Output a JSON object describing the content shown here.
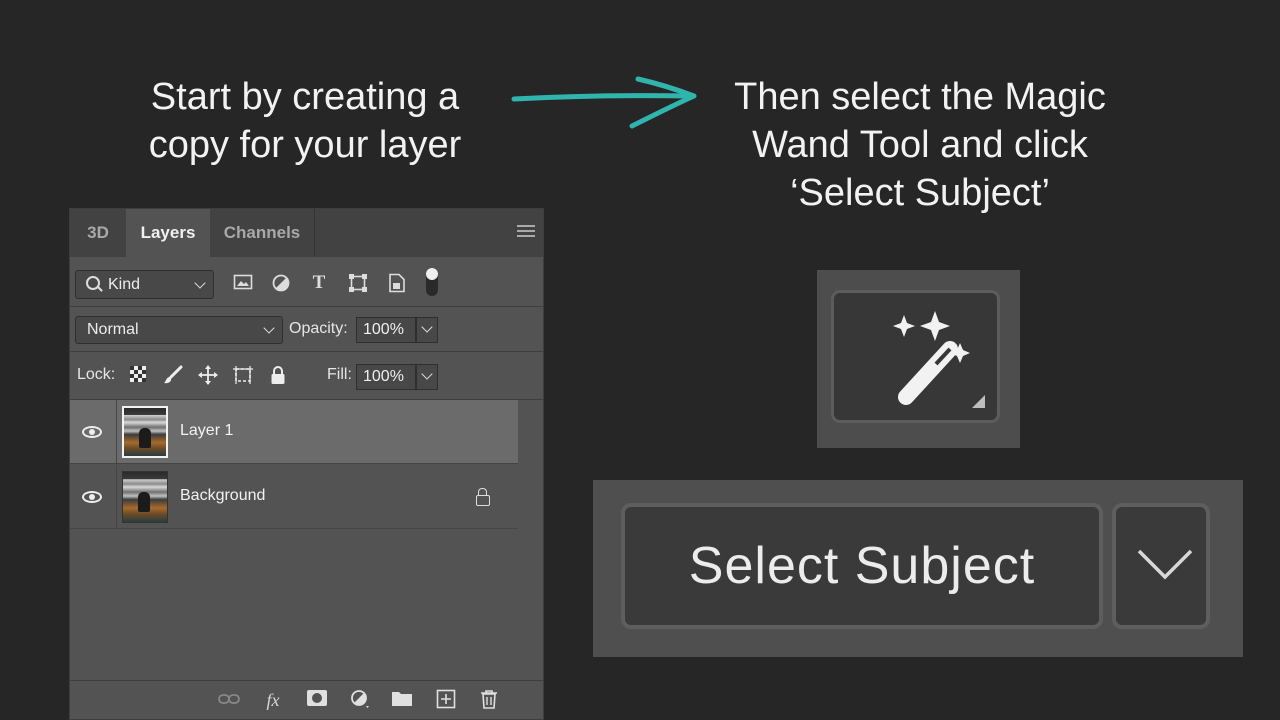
{
  "captions": {
    "left_line1": "Start by creating a",
    "left_line2": "copy for your layer",
    "right_line1": "Then select the Magic",
    "right_line2": "Wand Tool and click",
    "right_line3": "‘Select Subject’",
    "arrow_color": "#2fb5ad"
  },
  "panel": {
    "tabs": [
      "3D",
      "Layers",
      "Channels"
    ],
    "active_tab": "Layers",
    "filter": {
      "kind_label": "Kind",
      "icons": [
        "image-filter-icon",
        "adjustment-filter-icon",
        "type-filter-icon",
        "shape-filter-icon",
        "smart-object-filter-icon"
      ]
    },
    "blend_mode": "Normal",
    "opacity_label": "Opacity:",
    "opacity_value": "100%",
    "lock_label": "Lock:",
    "fill_label": "Fill:",
    "fill_value": "100%",
    "layers": [
      {
        "name": "Layer 1",
        "selected": true,
        "visible": true,
        "locked": false
      },
      {
        "name": "Background",
        "selected": false,
        "visible": true,
        "locked": true
      }
    ],
    "bottom_icons": [
      "link-icon",
      "fx-icon",
      "mask-icon",
      "adjustment-icon",
      "folder-icon",
      "new-layer-icon",
      "trash-icon"
    ]
  },
  "tools": {
    "magic_wand_icon": "magic-wand-icon",
    "select_subject_label": "Select Subject"
  }
}
